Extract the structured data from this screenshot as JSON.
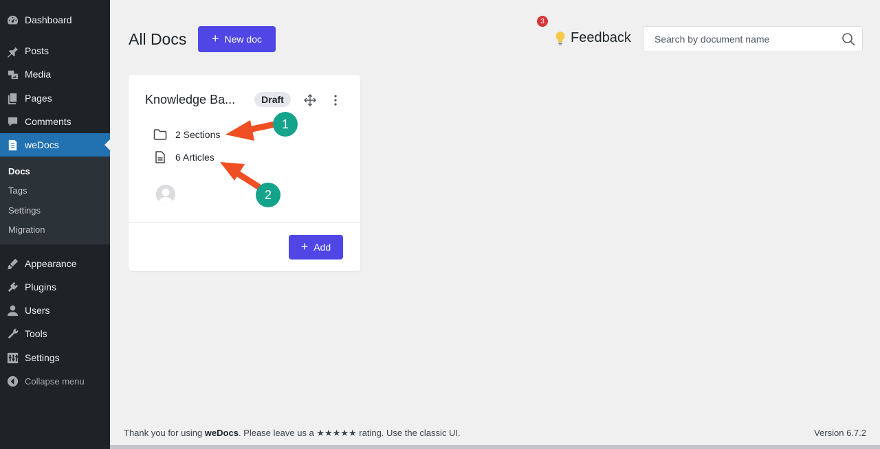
{
  "sidebar": {
    "items": [
      {
        "label": "Dashboard",
        "icon": "dashboard-icon"
      },
      {
        "label": "Posts",
        "icon": "pin-icon"
      },
      {
        "label": "Media",
        "icon": "media-icon"
      },
      {
        "label": "Pages",
        "icon": "pages-icon"
      },
      {
        "label": "Comments",
        "icon": "comment-icon"
      },
      {
        "label": "weDocs",
        "icon": "document-icon"
      },
      {
        "label": "Appearance",
        "icon": "brush-icon"
      },
      {
        "label": "Plugins",
        "icon": "plugin-icon"
      },
      {
        "label": "Users",
        "icon": "user-icon"
      },
      {
        "label": "Tools",
        "icon": "wrench-icon"
      },
      {
        "label": "Settings",
        "icon": "sliders-icon"
      },
      {
        "label": "Collapse menu",
        "icon": "collapse-icon"
      }
    ],
    "submenu": [
      "Docs",
      "Tags",
      "Settings",
      "Migration"
    ]
  },
  "header": {
    "title": "All Docs",
    "new_doc_label": "New doc",
    "feedback_label": "Feedback",
    "feedback_count": "3",
    "search_placeholder": "Search by document name"
  },
  "card": {
    "title": "Knowledge Ba...",
    "status": "Draft",
    "sections": "2 Sections",
    "articles": "6 Articles",
    "add_label": "Add"
  },
  "annotations": {
    "marker_1": "1",
    "marker_2": "2"
  },
  "footer": {
    "prefix": "Thank you for using ",
    "brand": "weDocs",
    "suffix": ". Please leave us a ★★★★★ rating. Use the classic UI.",
    "version": "Version 6.7.2"
  },
  "colors": {
    "sidebar_bg": "#1d2327",
    "active": "#2271b1",
    "primary_button": "#4f46e5",
    "marker": "#14a38b",
    "arrow": "#f04e23",
    "badge": "#d63638"
  }
}
